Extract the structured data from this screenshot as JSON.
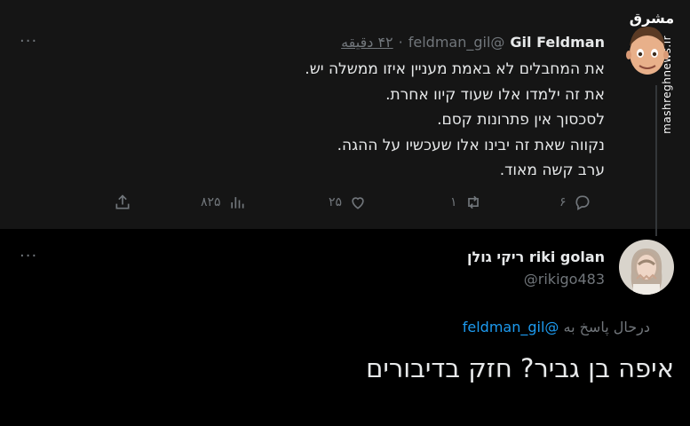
{
  "tweet": {
    "name": "Gil Feldman",
    "handle": "@feldman_gil",
    "separator": "·",
    "time": "۴۲ دقیقه",
    "more": "···",
    "lines": [
      "את המחבלים לא באמת מעניין איזו ממשלה יש.",
      "את זה ילמדו אלו שעוד קיוו אחרת.",
      "לסכסוך אין פתרונות קסם.",
      "נקווה שאת זה יבינו אלו שעכשיו על ההגה.",
      "ערב קשה מאוד."
    ],
    "actions": {
      "replies": "۶",
      "retweets": "۱",
      "likes": "۲۵",
      "views": "۸۲۵"
    },
    "watermark_logo": "مشرق",
    "watermark_site": "mashreghnews.ir"
  },
  "reply": {
    "name": "riki golan ריקי גולן",
    "handle": "@rikigo483",
    "more": "···",
    "replying_to_prefix": "درحال پاسخ به",
    "replying_to_handle": "@feldman_gil",
    "text": "איפה בן גביר? חזק בדיבורים"
  },
  "colors": {
    "accent": "#1d9bf0",
    "muted": "#71767b",
    "text": "#e7e9ea",
    "bg_top": "#151515",
    "bg_bottom": "#000000"
  },
  "icons": [
    "reply-icon",
    "retweet-icon",
    "like-icon",
    "views-icon",
    "share-icon",
    "more-icon"
  ]
}
